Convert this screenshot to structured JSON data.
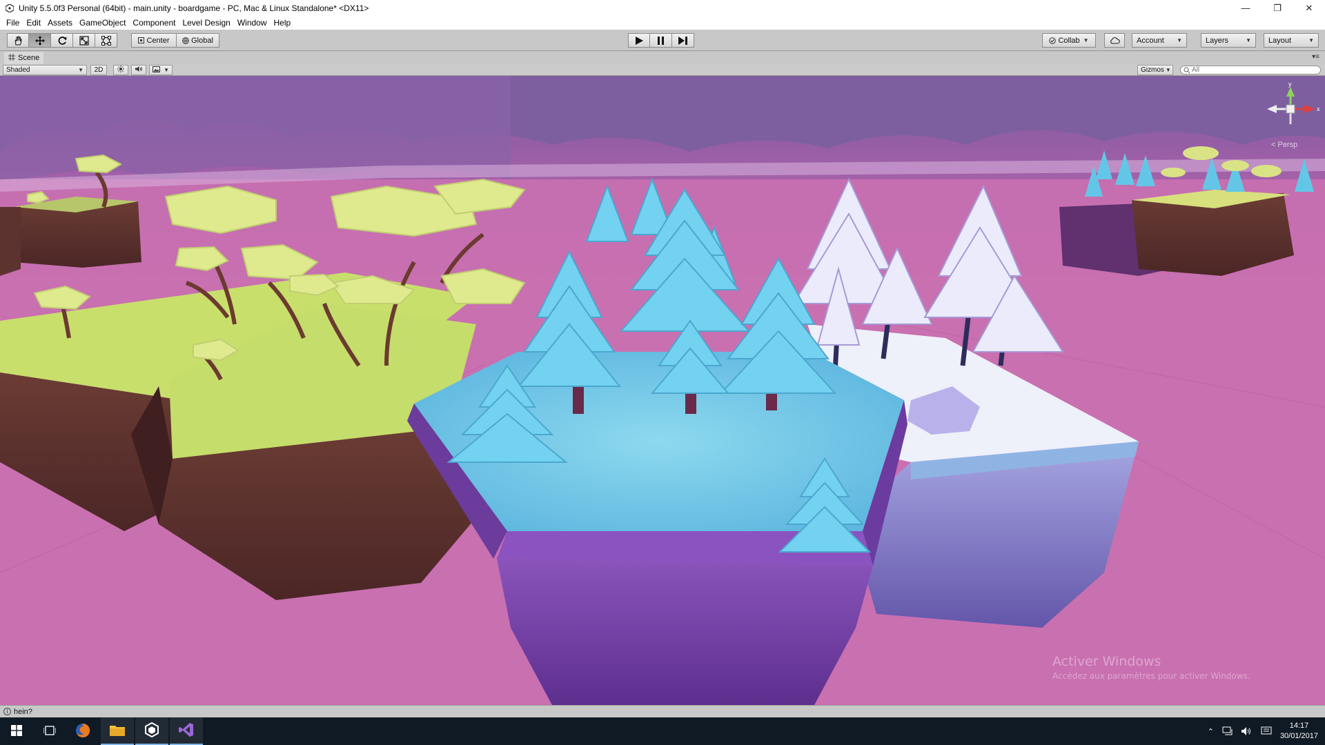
{
  "window": {
    "title": "Unity 5.5.0f3 Personal (64bit) - main.unity - boardgame - PC, Mac & Linux Standalone* <DX11>",
    "minimize": "—",
    "restore": "❐",
    "close": "✕"
  },
  "menu": [
    "File",
    "Edit",
    "Assets",
    "GameObject",
    "Component",
    "Level Design",
    "Window",
    "Help"
  ],
  "toolbar": {
    "transform_tools": [
      "hand-tool",
      "move-tool",
      "rotate-tool",
      "scale-tool",
      "rect-tool"
    ],
    "active_tool": "move-tool",
    "pivot_label": "Center",
    "space_label": "Global",
    "collab_label": "Collab",
    "account_label": "Account",
    "layers_label": "Layers",
    "layout_label": "Layout"
  },
  "scene_tab": {
    "label": "Scene"
  },
  "scene_toolbar": {
    "draw_mode": "Shaded",
    "mode_2d": "2D",
    "gizmos_label": "Gizmos",
    "search_placeholder": "All"
  },
  "viewport": {
    "gizmo_label": "< Persp",
    "gizmo_axes": {
      "y": "y",
      "x": "x"
    },
    "watermark_title": "Activer Windows",
    "watermark_sub": "Accédez aux paramètres pour activer Windows."
  },
  "status": {
    "message": "hein?"
  },
  "taskbar": {
    "apps": [
      "windows-start",
      "task-view",
      "firefox",
      "file-explorer",
      "unity",
      "visual-studio"
    ],
    "time": "14:17",
    "date": "30/01/2017"
  },
  "colors": {
    "sky": "#c970b0",
    "clouds": "#7d5fa0",
    "grass_top": "#c9e07a",
    "dirt_side": "#5e3430",
    "ice_top": "#78cde8",
    "ice_side": "#7b47ad",
    "snow_top": "#eef0fa",
    "snow_side": "#8a86c8",
    "tree_ice": "#6fd4ef",
    "tree_grass": "#d9e88c"
  }
}
